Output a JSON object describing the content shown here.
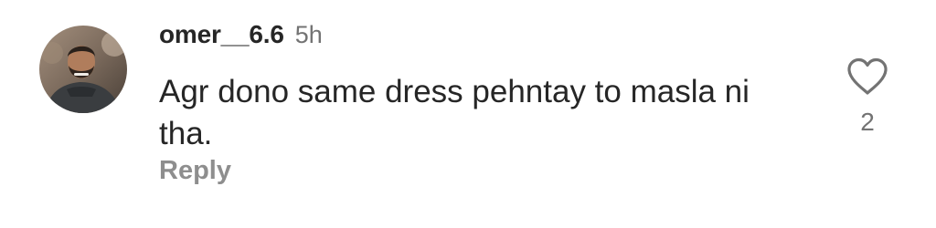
{
  "comment": {
    "username": "omer__6.6",
    "timestamp": "5h",
    "text": "Agr dono same dress pehntay to masla ni tha.",
    "reply_label": "Reply",
    "like_count": "2",
    "like_icon": "heart-outline-icon"
  },
  "colors": {
    "text_primary": "#262626",
    "text_secondary": "#737373",
    "reply": "#8e8e8e"
  }
}
